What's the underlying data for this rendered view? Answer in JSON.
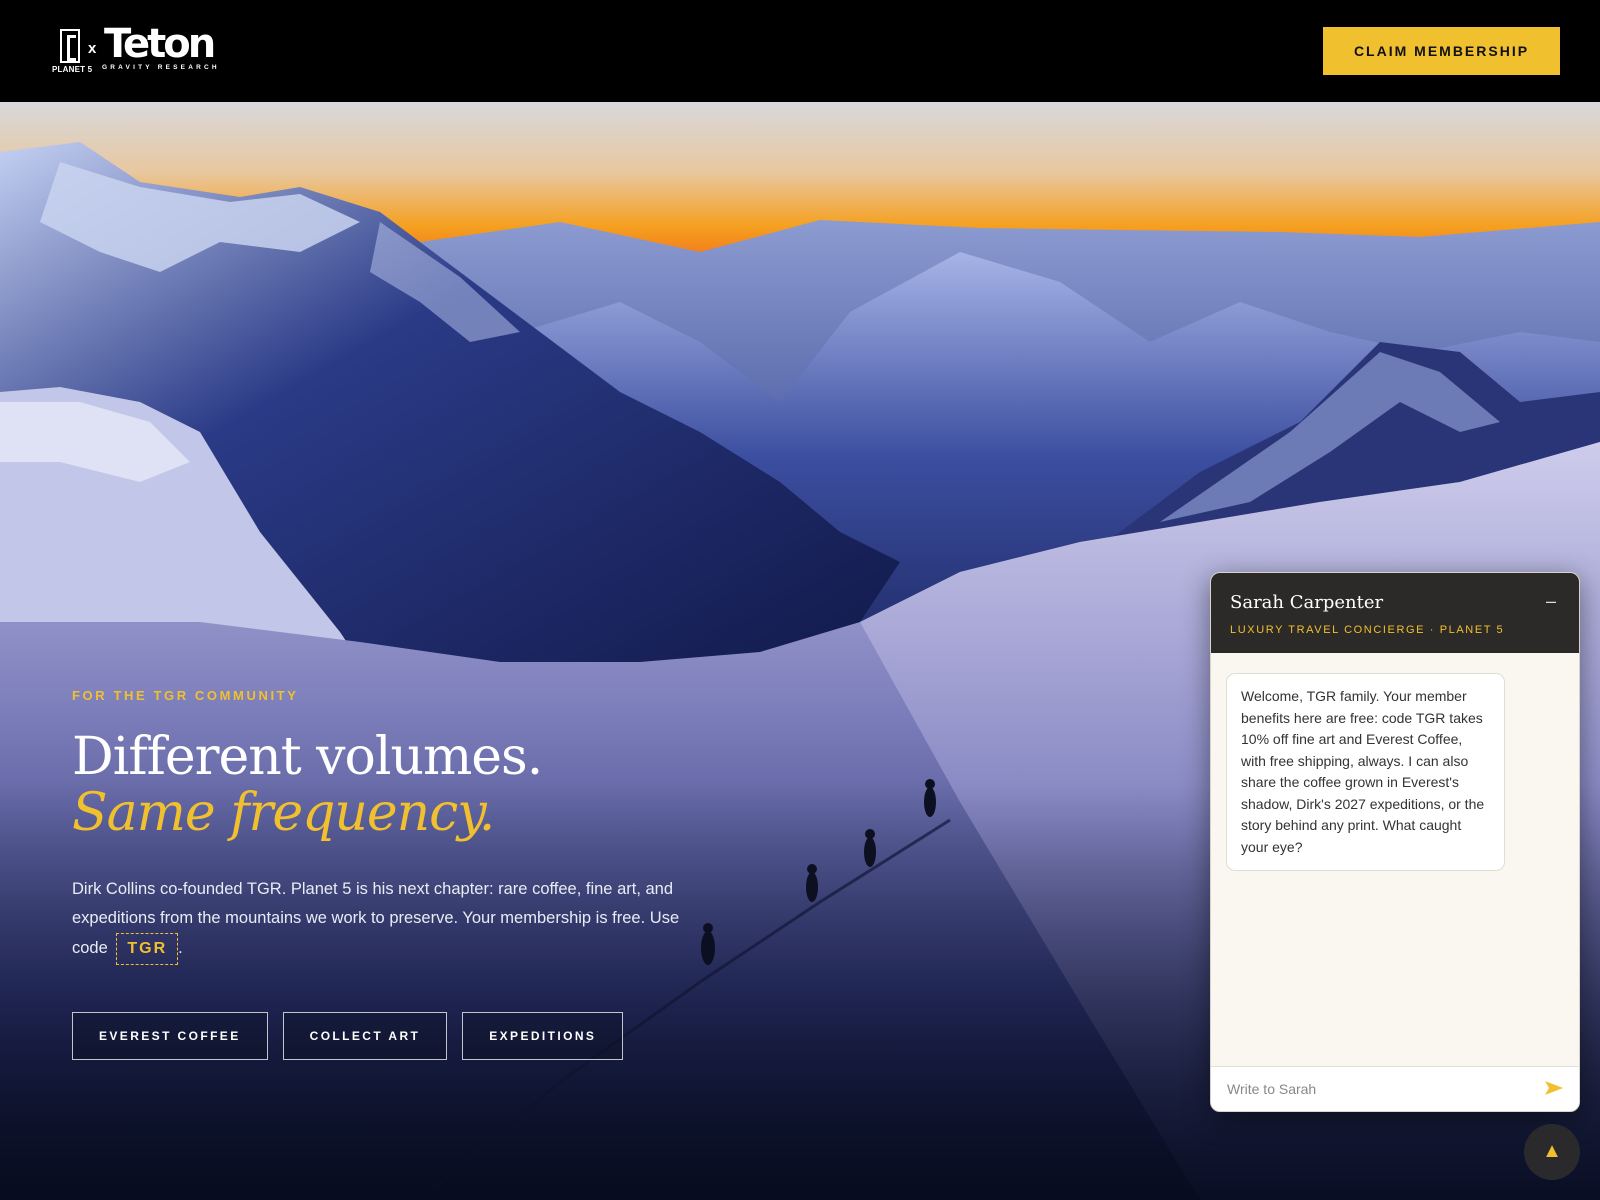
{
  "header": {
    "logo": {
      "planet_text": "PLANET 5",
      "x_text": "x",
      "teton_text": "Teton",
      "gravity_text": "GRAVITY RESEARCH"
    },
    "claim_label": "CLAIM MEMBERSHIP"
  },
  "hero": {
    "eyebrow": "FOR THE TGR COMMUNITY",
    "headline_line1": "Different volumes.",
    "headline_line2": "Same frequency.",
    "body_text": "Dirk Collins co-founded TGR. Planet 5 is his next chapter: rare coffee, fine art, and expeditions from the mountains we work to preserve. Your membership is free. Use code",
    "promo_code": "TGR",
    "body_end": ".",
    "ctas": [
      {
        "label": "EVEREST COFFEE"
      },
      {
        "label": "COLLECT ART"
      },
      {
        "label": "EXPEDITIONS"
      }
    ]
  },
  "chat": {
    "agent_name": "Sarah Carpenter",
    "agent_role": "LUXURY TRAVEL CONCIERGE · PLANET 5",
    "minimize_glyph": "–",
    "message": "Welcome, TGR family. Your member benefits here are free: code TGR takes 10% off fine art and Everest Coffee, with free shipping, always. I can also share the coffee grown in Everest's shadow, Dirk's 2027 expeditions, or the story behind any print. What caught your eye?",
    "input_placeholder": "Write to Sarah",
    "input_value": ""
  },
  "scroll_top_glyph": "▲",
  "icons": {
    "send": "send-arrow-icon",
    "minimize": "minimize-icon",
    "scroll_top": "chevron-up-icon"
  },
  "colors": {
    "accent": "#f0c02e",
    "header_bg": "#000000",
    "chat_header_bg": "#2b2a28",
    "chat_bg": "#faf7f1"
  }
}
